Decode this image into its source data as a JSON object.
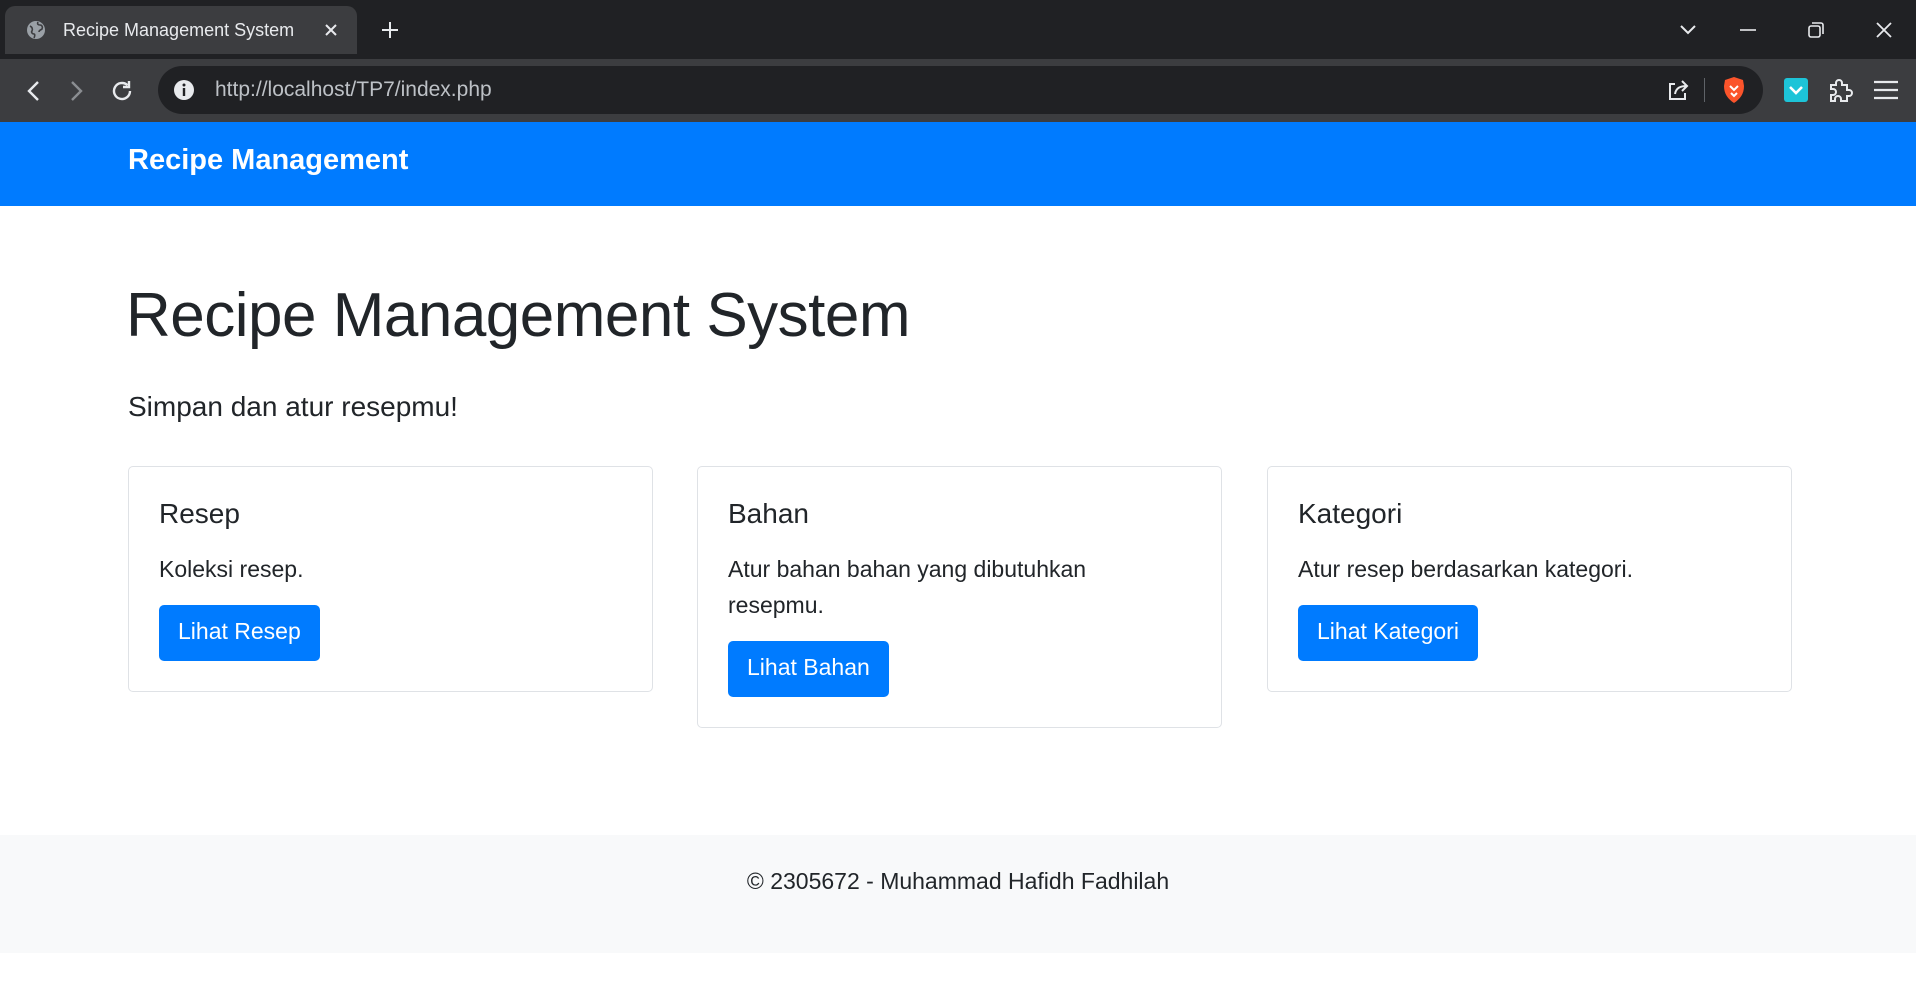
{
  "browser": {
    "tab_title": "Recipe Management System",
    "url": "http://localhost/TP7/index.php",
    "icons": {
      "favicon": "globe-icon",
      "close": "close-icon",
      "new_tab": "plus-icon",
      "back": "back-arrow-icon",
      "forward": "forward-arrow-icon",
      "reload": "reload-icon",
      "info": "info-icon",
      "share": "share-icon",
      "brave": "brave-shield-icon",
      "extension": "extension-icon",
      "puzzle": "puzzle-icon",
      "menu": "hamburger-menu-icon"
    }
  },
  "navbar": {
    "brand": "Recipe Management"
  },
  "hero": {
    "title": "Recipe Management System",
    "lead": "Simpan dan atur resepmu!"
  },
  "cards": [
    {
      "title": "Resep",
      "text": "Koleksi resep.",
      "button": "Lihat Resep"
    },
    {
      "title": "Bahan",
      "text": "Atur bahan bahan yang dibutuhkan resepmu.",
      "button": "Lihat Bahan"
    },
    {
      "title": "Kategori",
      "text": "Atur resep berdasarkan kategori.",
      "button": "Lihat Kategori"
    }
  ],
  "footer": {
    "text": "© 2305672 - Muhammad Hafidh Fadhilah"
  },
  "colors": {
    "primary": "#007bff",
    "footer_bg": "#f8f9fa",
    "chrome_dark": "#202124",
    "chrome_toolbar": "#3c3d40"
  }
}
